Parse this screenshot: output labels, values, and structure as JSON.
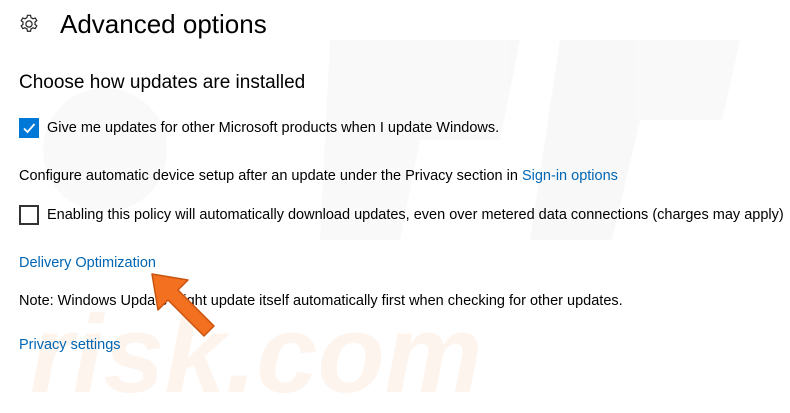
{
  "header": {
    "icon": "gear-icon",
    "title": "Advanced options"
  },
  "section": {
    "heading": "Choose how updates are installed"
  },
  "options": {
    "microsoft_products": {
      "label": "Give me updates for other Microsoft products when I update Windows.",
      "checked": true
    },
    "device_setup_text": "Configure automatic device setup after an update under the Privacy section in ",
    "signin_link": "Sign-in options",
    "metered": {
      "label": "Enabling this policy will automatically download updates, even over metered data connections (charges may apply)",
      "checked": false
    }
  },
  "links": {
    "delivery_optimization": "Delivery Optimization",
    "privacy_settings": "Privacy settings"
  },
  "note": "Note: Windows Update might update itself automatically first when checking for other updates.",
  "watermark": {
    "text": "risk.com"
  },
  "colors": {
    "accent": "#0078d7",
    "link": "#0066b4",
    "arrow": "#f37021"
  }
}
